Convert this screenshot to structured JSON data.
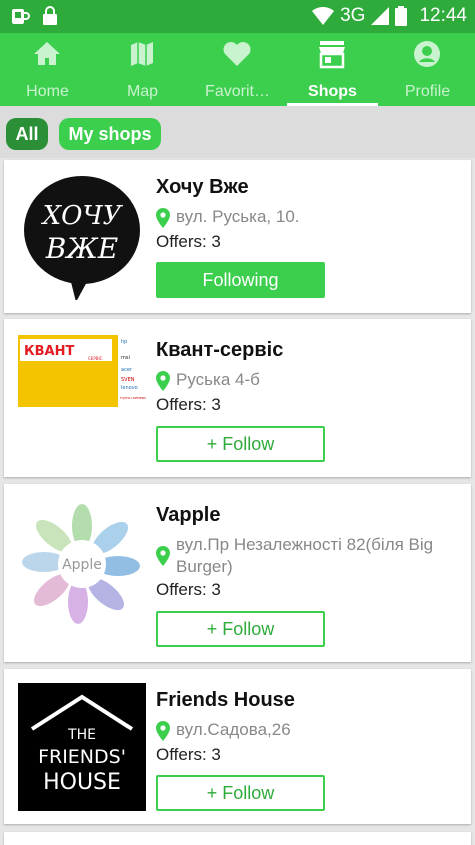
{
  "status_bar": {
    "left_icons": [
      "coffee-icon",
      "lock-icon"
    ],
    "network": "3G",
    "time": "12:44"
  },
  "tabs": [
    {
      "label": "Home",
      "icon": "home-icon",
      "active": false
    },
    {
      "label": "Map",
      "icon": "map-icon",
      "active": false
    },
    {
      "label": "Favorit…",
      "icon": "heart-icon",
      "active": false
    },
    {
      "label": "Shops",
      "icon": "shop-icon",
      "active": true
    },
    {
      "label": "Profile",
      "icon": "profile-icon",
      "active": false
    }
  ],
  "filters": {
    "all": "All",
    "my_shops": "My shops"
  },
  "shops": [
    {
      "name": "Хочу Вже",
      "address": "вул. Руська, 10.",
      "offers": "Offers: 3",
      "button": "Following",
      "following": true,
      "logo_text": [
        "ХОЧУ",
        "ВЖЕ"
      ]
    },
    {
      "name": "Квант-сервіс",
      "address": "Руська 4-б",
      "offers": "Offers: 3",
      "button": "+ Follow",
      "following": false,
      "logo_text": [
        "КВАНТ",
        "СЕРВІС",
        "hp",
        "msi",
        "acer",
        "SVEN",
        "lenovo",
        "FUJITSU SIEMENS"
      ]
    },
    {
      "name": "Vapple",
      "address": "вул.Пр Незалежності 82(біля Big Burger)",
      "offers": "Offers: 3",
      "button": "+ Follow",
      "following": false,
      "logo_text": [
        "Apple"
      ]
    },
    {
      "name": "Friends House",
      "address": "вул.Садова,26",
      "offers": "Offers: 3",
      "button": "+ Follow",
      "following": false,
      "logo_text": [
        "THE",
        "FRIENDS'",
        "HOUSE"
      ]
    }
  ],
  "colors": {
    "primary": "#3ccf4e",
    "dark": "#2eab3a",
    "chip_selected": "#2a8f37",
    "pin": "#3ccf4e"
  }
}
